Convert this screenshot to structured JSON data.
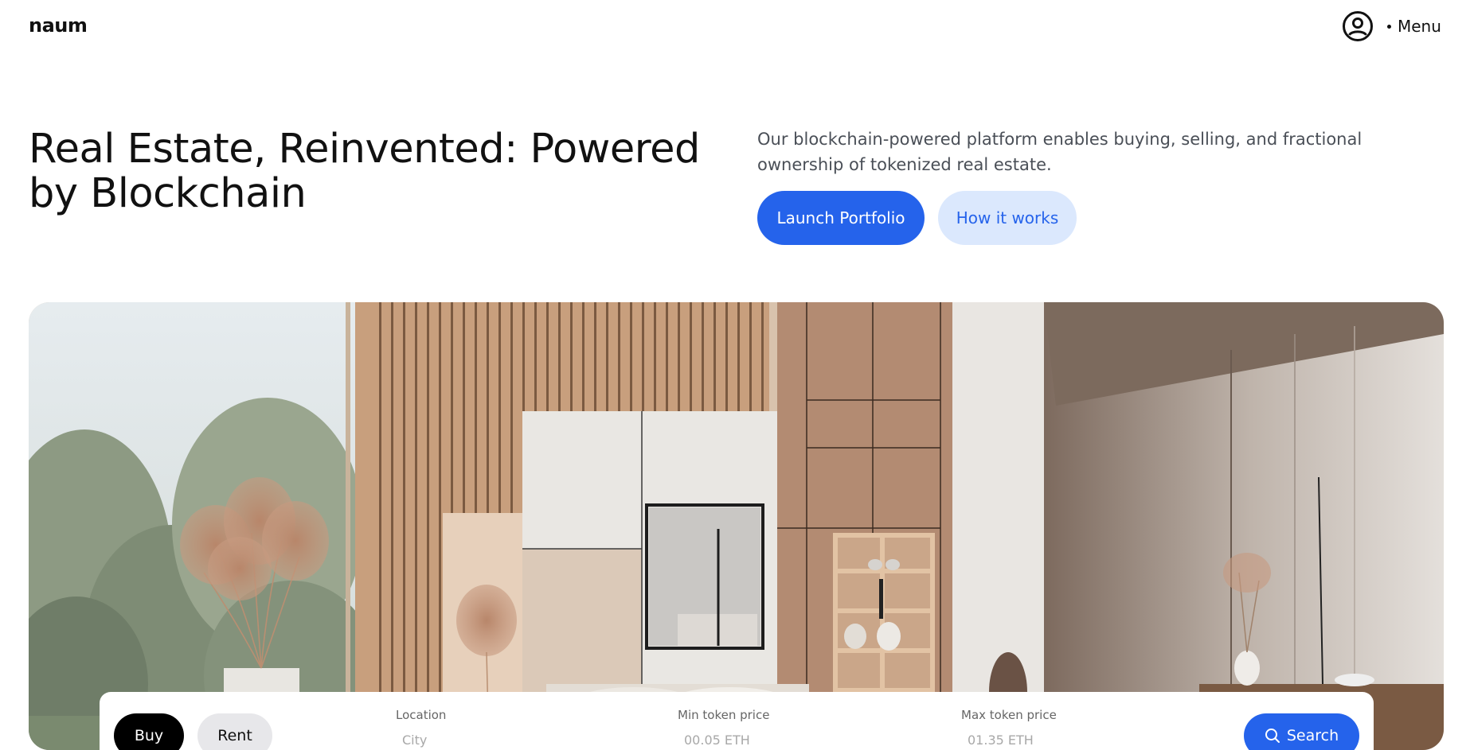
{
  "header": {
    "logo": "naum",
    "user_icon": "user-circle-icon",
    "menu_label": "Menu"
  },
  "hero": {
    "title": "Real Estate, Reinvented: Powered by Blockchain",
    "description": "Our blockchain-powered platform enables buying, selling, and fractional ownership of tokenized real estate.",
    "primary_button": "Launch Portfolio",
    "secondary_button": "How it works"
  },
  "search": {
    "tabs": [
      "Buy",
      "Rent"
    ],
    "active_tab": "Buy",
    "location_label": "Location",
    "location_placeholder": "City",
    "min_price_label": "Min token price",
    "min_price_placeholder": "00.05 ETH",
    "max_price_label": "Max token price",
    "max_price_placeholder": "01.35 ETH",
    "search_button": "Search",
    "search_icon": "search-icon"
  },
  "colors": {
    "accent": "#2563eb",
    "accent_light": "#dbe8fd",
    "text_dark": "#111111",
    "text_muted": "#4a4f57"
  }
}
